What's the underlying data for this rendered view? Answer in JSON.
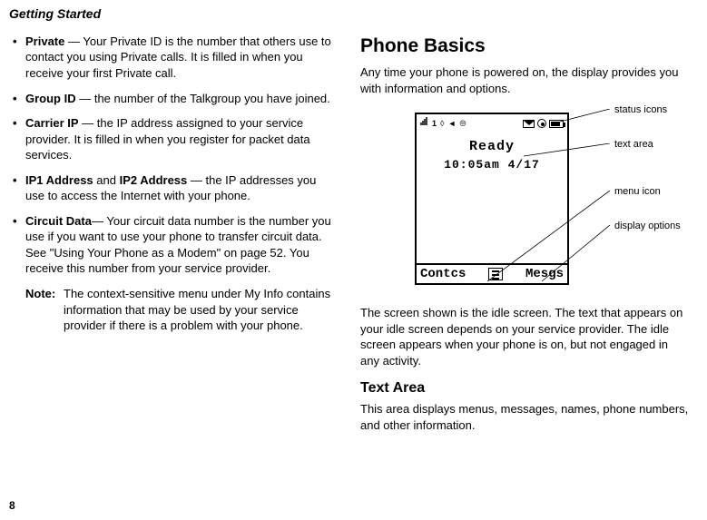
{
  "header": "Getting Started",
  "pageNumber": "8",
  "left": {
    "bullets": [
      {
        "label": "Private",
        "text": " — Your Private ID is the number that others use to contact you using Private calls. It is filled in when you receive your first Private call."
      },
      {
        "label": "Group ID",
        "text": " — the number of the Talkgroup you have joined."
      },
      {
        "label": "Carrier IP",
        "text": " — the IP address assigned to your service provider. It is filled in when you register for packet data services."
      },
      {
        "label": "IP1 Address",
        "mid": " and ",
        "label2": "IP2 Address",
        "text": " — the IP addresses you use to access the Internet with your phone."
      },
      {
        "label": "Circuit Data",
        "text": "— Your circuit data number is the number you use if you want to use your phone to transfer circuit data. See \"Using Your Phone as a Modem\" on page 52. You receive this number from your service provider."
      }
    ],
    "noteLabel": "Note:",
    "noteText": "The context-sensitive menu under My Info contains information that may be used by your service provider if there is a problem with your phone."
  },
  "right": {
    "heading": "Phone Basics",
    "intro": "Any time your phone is powered on, the display provides you with information and options.",
    "screen": {
      "readyText": "Ready",
      "timeText": "10:05am 4/17",
      "leftSoft": "Contcs",
      "rightSoft": "Mesgs"
    },
    "callouts": {
      "statusIcons": "status icons",
      "textArea": "text area",
      "menuIcon": "menu icon",
      "displayOptions": "display options"
    },
    "belowFigure": "The screen shown is the idle screen. The text that appears on your idle screen depends on your service provider. The idle screen appears when your phone is on, but not engaged in any activity.",
    "subheading": "Text Area",
    "subText": "This area displays menus, messages, names, phone numbers, and other information."
  }
}
